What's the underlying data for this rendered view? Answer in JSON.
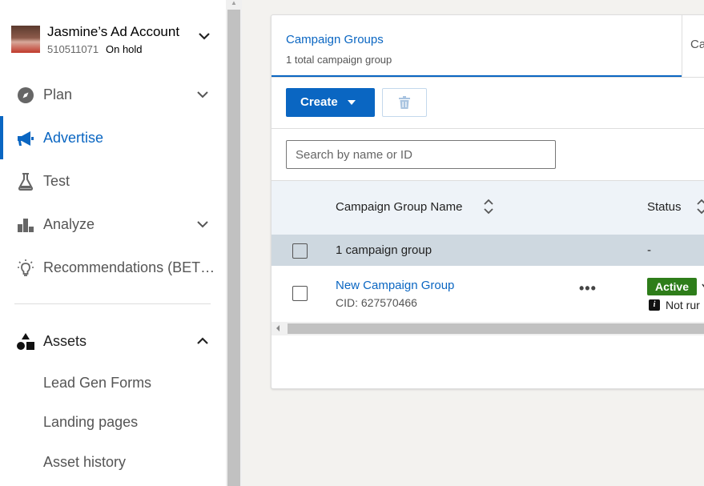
{
  "account": {
    "name": "Jasmine’s Ad Account",
    "id": "510511071",
    "status": "On hold"
  },
  "nav": {
    "plan": "Plan",
    "advertise": "Advertise",
    "test": "Test",
    "analyze": "Analyze",
    "recommendations": "Recommendations (BET…",
    "assets": "Assets"
  },
  "assets_items": [
    "Lead Gen Forms",
    "Landing pages",
    "Asset history"
  ],
  "tabs": {
    "campaign_groups": "Campaign Groups",
    "campaign_groups_sub": "1 total campaign group",
    "next_tab": "Ca"
  },
  "toolbar": {
    "create_label": "Create"
  },
  "search": {
    "placeholder": "Search by name or ID"
  },
  "table": {
    "col_name": "Campaign Group Name",
    "col_status": "Status",
    "summary_label": "1 campaign group",
    "summary_status": "-",
    "rows": [
      {
        "name": "New Campaign Group",
        "cid": "CID: 627570466",
        "more": "•••",
        "status": "Active",
        "status_note": "Not rur"
      }
    ]
  },
  "colors": {
    "accent": "#0a66c2",
    "active_badge": "#2e7d1a"
  }
}
